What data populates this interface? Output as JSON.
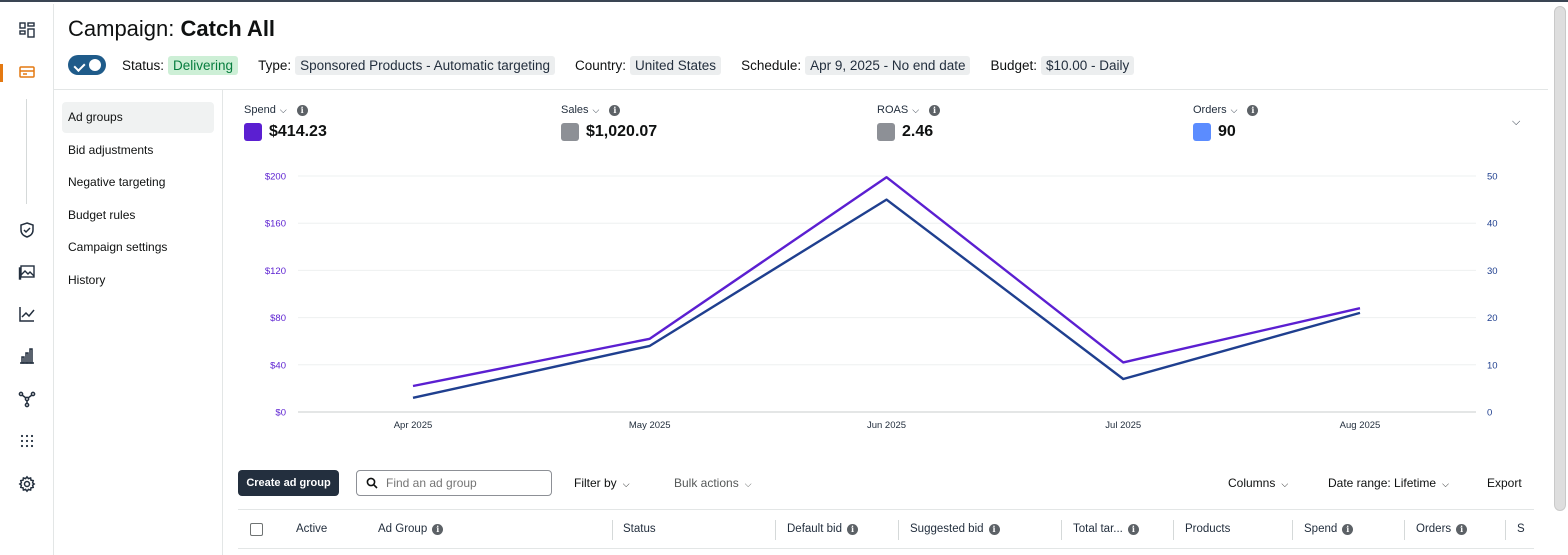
{
  "header": {
    "title_prefix": "Campaign: ",
    "title_name": "Catch All",
    "status_label": "Status:",
    "status_value": "Delivering",
    "type_label": "Type:",
    "type_value": "Sponsored Products - Automatic targeting",
    "country_label": "Country:",
    "country_value": "United States",
    "schedule_label": "Schedule:",
    "schedule_value": "Apr 9, 2025 - No end date",
    "budget_label": "Budget:",
    "budget_value": "$10.00 - Daily"
  },
  "subnav": {
    "items": [
      {
        "label": "Ad groups"
      },
      {
        "label": "Bid adjustments"
      },
      {
        "label": "Negative targeting"
      },
      {
        "label": "Budget rules"
      },
      {
        "label": "Campaign settings"
      },
      {
        "label": "History"
      }
    ]
  },
  "metrics": [
    {
      "label": "Spend",
      "value": "$414.23",
      "color": "#5b1fd1"
    },
    {
      "label": "Sales",
      "value": "$1,020.07",
      "color": "#8d9096"
    },
    {
      "label": "ROAS",
      "value": "2.46",
      "color": "#8d9096"
    },
    {
      "label": "Orders",
      "value": "90",
      "color": "#5b8cff"
    }
  ],
  "toolbar": {
    "create_label": "Create ad group",
    "search_placeholder": "Find an ad group",
    "filter_label": "Filter by",
    "bulk_label": "Bulk actions",
    "columns_label": "Columns",
    "date_range_label": "Date range: Lifetime",
    "export_label": "Export"
  },
  "table": {
    "columns": [
      "Active",
      "Ad Group",
      "Status",
      "Default bid",
      "Suggested bid",
      "Total tar...",
      "Products",
      "Spend",
      "Orders",
      "S"
    ]
  },
  "chart_data": {
    "type": "line",
    "x": [
      "Apr 2025",
      "May 2025",
      "Jun 2025",
      "Jul 2025",
      "Aug 2025"
    ],
    "left_axis": {
      "ticks": [
        "$0",
        "$40",
        "$80",
        "$120",
        "$160",
        "$200"
      ],
      "ylim": [
        0,
        200
      ]
    },
    "right_axis": {
      "ticks": [
        "0",
        "10",
        "20",
        "30",
        "40",
        "50"
      ],
      "ylim": [
        0,
        50
      ]
    },
    "series": [
      {
        "name": "Spend",
        "axis": "left",
        "color": "#5b1fd1",
        "values": [
          22,
          62,
          199,
          42,
          88
        ]
      },
      {
        "name": "Orders",
        "axis": "right",
        "color": "#1f3f8f",
        "values": [
          3,
          14,
          45,
          7,
          21
        ]
      }
    ],
    "grid": true,
    "legend": "none"
  }
}
